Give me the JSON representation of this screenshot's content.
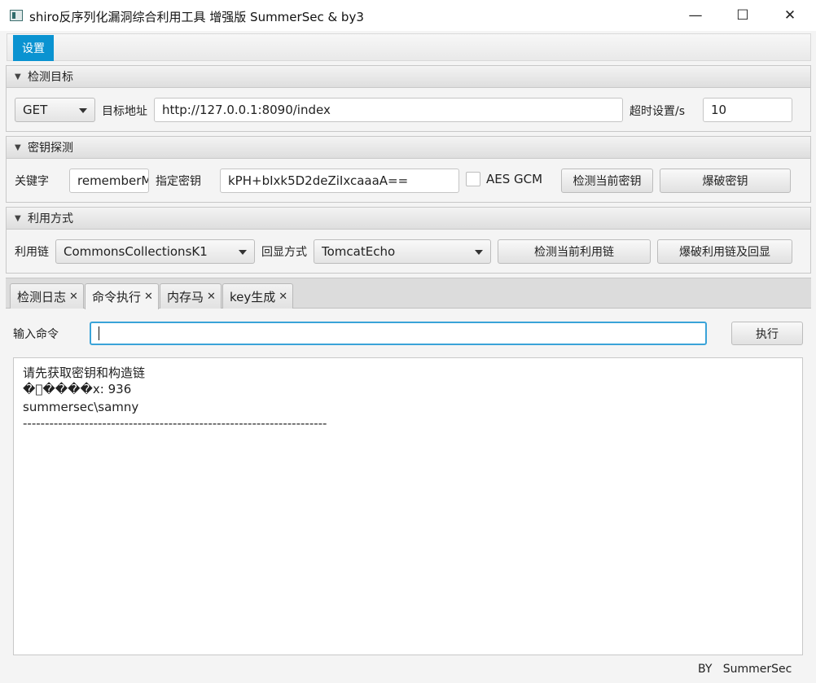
{
  "window": {
    "title": "shiro反序列化漏洞综合利用工具 增强版 SummerSec & by3",
    "minimize_glyph": "—",
    "maximize_glyph": "☐",
    "close_glyph": "✕"
  },
  "menu": {
    "settings": "设置"
  },
  "detect_target": {
    "header": "检测目标",
    "method": "GET",
    "url_label": "目标地址",
    "url": "http://127.0.0.1:8090/index",
    "timeout_label": "超时设置/s",
    "timeout": "10"
  },
  "key_detect": {
    "header": "密钥探测",
    "keyword_label": "关键字",
    "keyword": "rememberM",
    "key_label": "指定密钥",
    "key": "kPH+bIxk5D2deZiIxcaaaA==",
    "aes_gcm_label": "AES GCM",
    "aes_gcm_checked": false,
    "check_key_button": "检测当前密钥",
    "brute_key_button": "爆破密钥"
  },
  "exploit": {
    "header": "利用方式",
    "chain_label": "利用链",
    "chain": "CommonsCollectionsK1",
    "echo_label": "回显方式",
    "echo": "TomcatEcho",
    "check_chain_button": "检测当前利用链",
    "brute_chain_button": "爆破利用链及回显"
  },
  "tabs": [
    {
      "label": "检测日志"
    },
    {
      "label": "命令执行",
      "active": true
    },
    {
      "label": "内存马"
    },
    {
      "label": "key生成"
    }
  ],
  "tab_close_glyph": "✕",
  "command": {
    "label": "输入命令",
    "value": "",
    "execute_button": "执行"
  },
  "output_lines": [
    "请先获取密钥和构造链",
    "�\u0000����x: 936",
    "summersec\\samny",
    "---------------------------------------------------------------------"
  ],
  "footer": "BY   SummerSec",
  "colors": {
    "accent": "#0a93d1",
    "focus_border": "#3aa3d8"
  }
}
